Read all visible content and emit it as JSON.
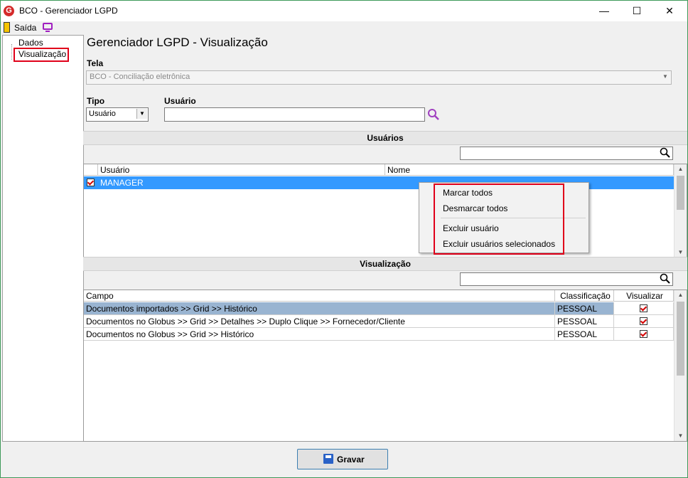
{
  "window": {
    "title": "BCO - Gerenciador LGPD",
    "logo_letter": "G",
    "minimize": "—",
    "maximize": "☐",
    "close": "✕"
  },
  "toolbar": {
    "exit_label": "Saída"
  },
  "tree": {
    "items": [
      {
        "label": "Dados"
      },
      {
        "label": "Visualização"
      }
    ]
  },
  "page": {
    "title": "Gerenciador LGPD - Visualização"
  },
  "form": {
    "tela_label": "Tela",
    "tela_value": "BCO - Conciliação eletrônica",
    "tipo_label": "Tipo",
    "tipo_value": "Usuário",
    "usuario_label": "Usuário",
    "usuario_value": ""
  },
  "users_section": {
    "title": "Usuários",
    "search_value": "",
    "columns": [
      "Usuário",
      "Nome"
    ],
    "rows": [
      {
        "checked": true,
        "usuario": "MANAGER",
        "nome": ""
      }
    ]
  },
  "context_menu": {
    "items": [
      "Marcar todos",
      "Desmarcar todos",
      "Excluir usuário",
      "Excluir usuários selecionados"
    ]
  },
  "view_section": {
    "title": "Visualização",
    "search_value": "",
    "columns": [
      "Campo",
      "Classificação",
      "Visualizar"
    ],
    "rows": [
      {
        "campo": "Documentos importados >> Grid >> Histórico",
        "classificacao": "PESSOAL",
        "visualizar": true
      },
      {
        "campo": "Documentos no Globus >> Grid >> Detalhes >> Duplo Clique >> Fornecedor/Cliente",
        "classificacao": "PESSOAL",
        "visualizar": true
      },
      {
        "campo": "Documentos no Globus >> Grid >> Histórico",
        "classificacao": "PESSOAL",
        "visualizar": true
      }
    ]
  },
  "actions": {
    "save_label": "Gravar"
  },
  "colors": {
    "accent": "#3399ff",
    "selection_row": "#99b4d1",
    "highlight_red": "#e0001a"
  }
}
